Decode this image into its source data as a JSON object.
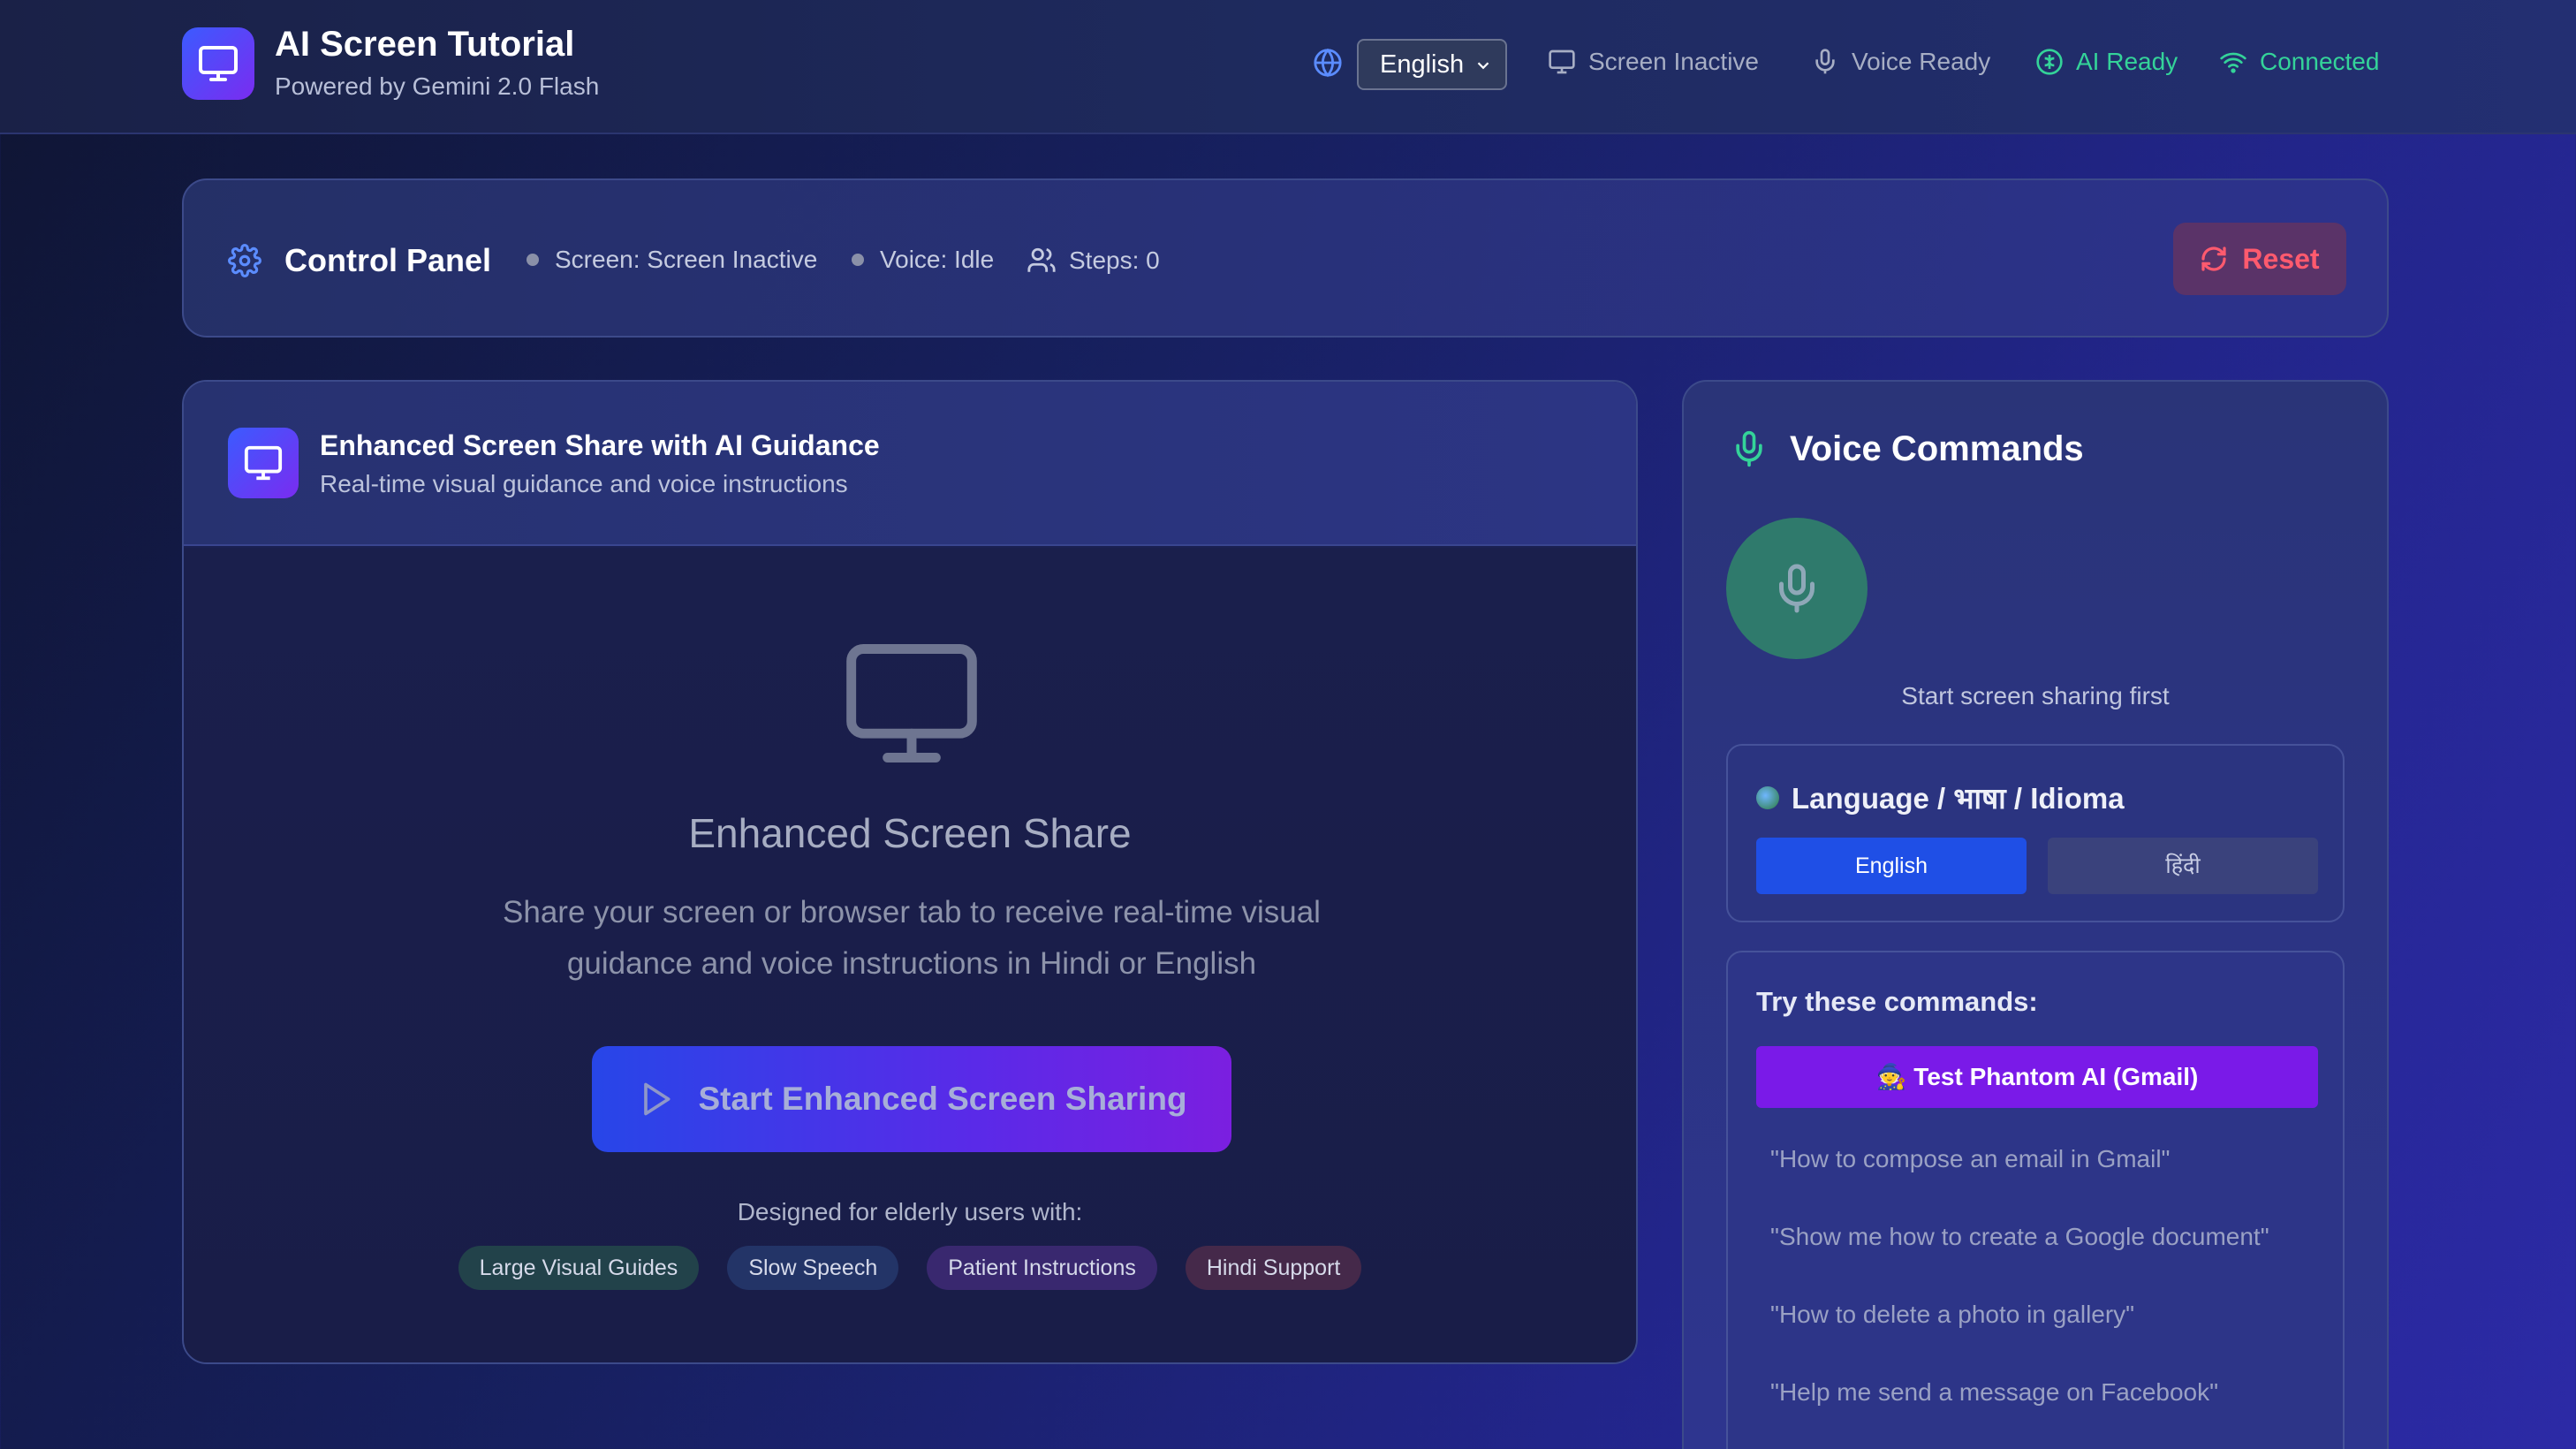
{
  "header": {
    "title": "AI Screen Tutorial",
    "subtitle": "Powered by Gemini 2.0 Flash",
    "language_selected": "English",
    "status": {
      "screen": "Screen Inactive",
      "voice": "Voice Ready",
      "ai": "AI Ready",
      "connection": "Connected"
    }
  },
  "control_panel": {
    "title": "Control Panel",
    "screen_status": "Screen: Screen Inactive",
    "voice_status": "Voice: Idle",
    "steps": "Steps: 0",
    "reset_label": "Reset"
  },
  "share_panel": {
    "title": "Enhanced Screen Share with AI Guidance",
    "subtitle": "Real-time visual guidance and voice instructions",
    "heading": "Enhanced Screen Share",
    "description": "Share your screen or browser tab to receive real-time visual guidance and voice instructions in Hindi or English",
    "start_label": "Start Enhanced Screen Sharing",
    "designed_for": "Designed for elderly users with:",
    "features": [
      "Large Visual Guides",
      "Slow Speech",
      "Patient Instructions",
      "Hindi Support"
    ]
  },
  "voice_panel": {
    "title": "Voice Commands",
    "mic_hint": "Start screen sharing first",
    "language_title": "Language / भाषा / Idioma",
    "language_options": [
      "English",
      "हिंदी"
    ],
    "commands_title": "Try these commands:",
    "phantom_label": "🧙 Test Phantom AI (Gmail)",
    "commands": [
      "\"How to compose an email in Gmail\"",
      "\"Show me how to create a Google document\"",
      "\"How to delete a photo in gallery\"",
      "\"Help me send a message on Facebook\""
    ]
  },
  "colors": {
    "accent_green": "#34d399",
    "accent_blue": "#1f4fe6",
    "accent_purple": "#7a1ae8",
    "reset_red": "#ff5a6e"
  },
  "icons": [
    "monitor-icon",
    "globe-icon",
    "chevron-down-icon",
    "mic-icon",
    "brain-icon",
    "wifi-icon",
    "gear-icon",
    "users-icon",
    "refresh-icon",
    "play-icon"
  ]
}
